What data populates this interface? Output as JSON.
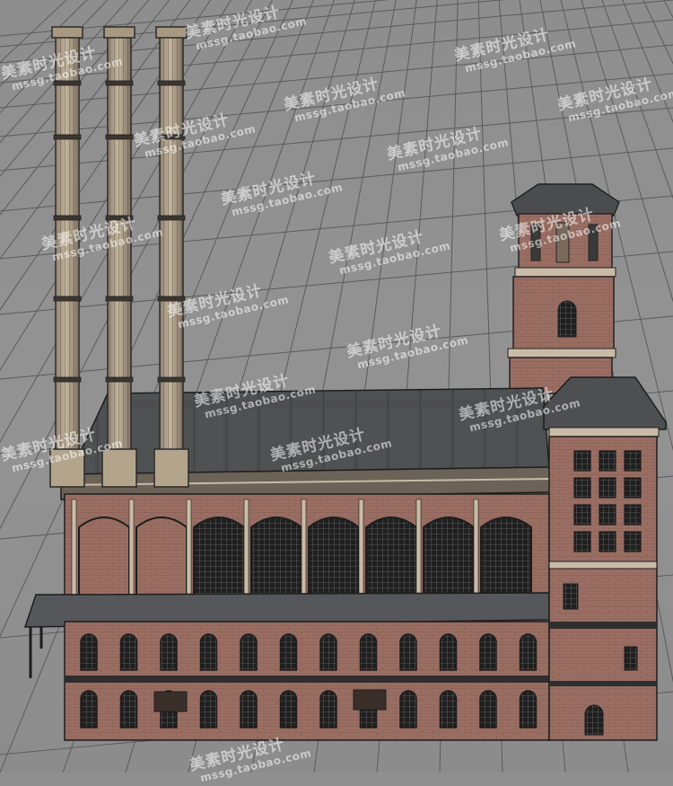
{
  "watermark": {
    "brand": "美素时光设计",
    "url": "mssg.taobao.com"
  },
  "colors": {
    "viewport_bg": "#8f8f8f",
    "grid_line": "#5b5b5b",
    "brick": "#9a6e63",
    "brick_dark": "#7a5249",
    "stone_trim": "#c9bba6",
    "roof": "#4f5153",
    "chimney": "#b4a58f",
    "window": "#2a2a2a"
  },
  "scene": {
    "chimney_count": 3,
    "top_arch_window_count": 8,
    "middle_row_window_count": 12,
    "lower_row_window_count": 12
  }
}
